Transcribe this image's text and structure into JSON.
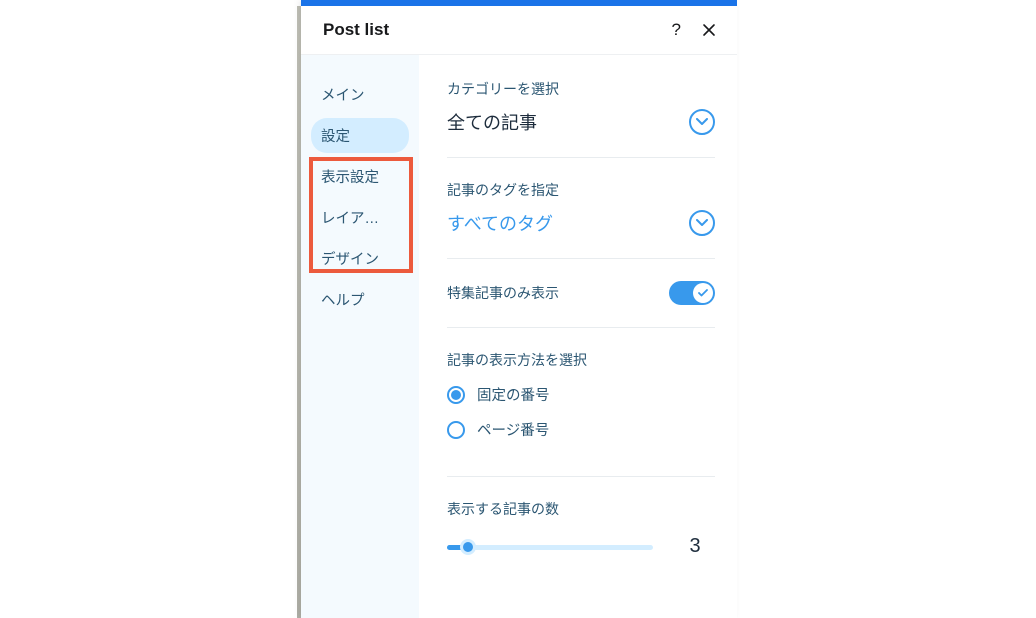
{
  "header": {
    "title": "Post list"
  },
  "sidebar": {
    "items": [
      {
        "label": "メイン",
        "active": false
      },
      {
        "label": "設定",
        "active": true
      },
      {
        "label": "表示設定",
        "active": false
      },
      {
        "label": "レイア…",
        "active": false
      },
      {
        "label": "デザイン",
        "active": false
      },
      {
        "label": "ヘルプ",
        "active": false
      }
    ]
  },
  "main": {
    "category": {
      "label": "カテゴリーを選択",
      "value": "全ての記事"
    },
    "tags": {
      "label": "記事のタグを指定",
      "value": "すべてのタグ"
    },
    "featured": {
      "label": "特集記事のみ表示",
      "value": true
    },
    "displayMethod": {
      "label": "記事の表示方法を選択",
      "options": [
        {
          "label": "固定の番号",
          "selected": true
        },
        {
          "label": "ページ番号",
          "selected": false
        }
      ]
    },
    "count": {
      "label": "表示する記事の数",
      "value": "3"
    }
  }
}
